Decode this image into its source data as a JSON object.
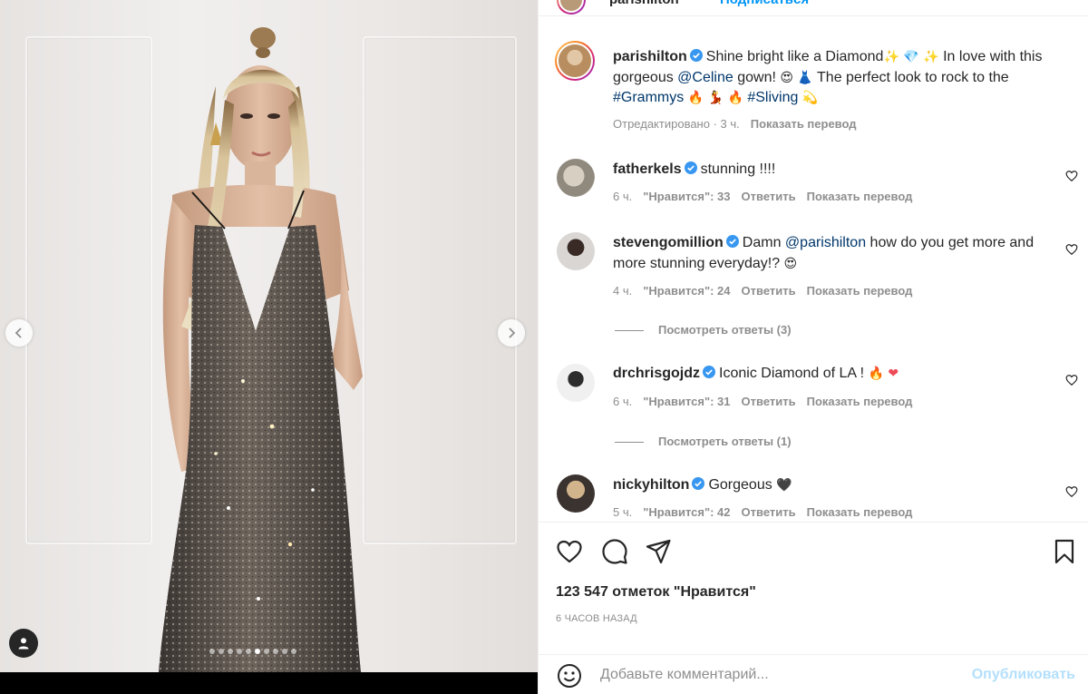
{
  "header": {
    "username": "parishilton",
    "follow_label": "Подписаться"
  },
  "media": {
    "slide_count": 10,
    "active_slide": 5
  },
  "caption": {
    "username": "parishilton",
    "text_1": "Shine bright like a Diamond",
    "emoji_1": "✨ 💎 ✨",
    "text_2": " In love with this gorgeous ",
    "mention": "@Celine",
    "text_3": " gown! ",
    "emoji_2": "😍 👗",
    "text_4": " The perfect look to rock to the ",
    "hashtag_1": "#Grammys",
    "emoji_3": " 🔥 💃 🔥 ",
    "hashtag_2": "#Sliving",
    "emoji_4": " 💫",
    "edited": "Отредактировано · 3 ч.",
    "translate": "Показать перевод"
  },
  "comments": [
    {
      "username": "fatherkels",
      "text": "stunning !!!!",
      "time": "6 ч.",
      "likes": "\"Нравится\": 33",
      "reply": "Ответить",
      "translate": "Показать перевод"
    },
    {
      "username": "stevengomillion",
      "text_a": "Damn ",
      "mention": "@parishilton",
      "text_b": " how do you get more and more stunning everyday!? ",
      "emoji": "😍",
      "time": "4 ч.",
      "likes": "\"Нравится\": 24",
      "reply": "Ответить",
      "translate": "Показать перевод",
      "view_replies": "Посмотреть ответы (3)"
    },
    {
      "username": "drchrisgojdz",
      "text": "Iconic Diamond of LA ! ",
      "emoji": "🔥 ❤",
      "time": "6 ч.",
      "likes": "\"Нравится\": 31",
      "reply": "Ответить",
      "translate": "Показать перевод",
      "view_replies": "Посмотреть ответы (1)"
    },
    {
      "username": "nickyhilton",
      "text": "Gorgeous ",
      "emoji": "🖤",
      "time": "5 ч.",
      "likes": "\"Нравится\": 42",
      "reply": "Ответить",
      "translate": "Показать перевод"
    }
  ],
  "stats": {
    "likes": "123 547 отметок \"Нравится\"",
    "posted": "6 ЧАСОВ НАЗАД"
  },
  "composer": {
    "placeholder": "Добавьте комментарий...",
    "publish_label": "Опубликовать"
  },
  "colors": {
    "verified": "#3897f0",
    "link": "#00376b",
    "muted": "#8e8e8e",
    "publish_disabled": "#b2dffc"
  }
}
